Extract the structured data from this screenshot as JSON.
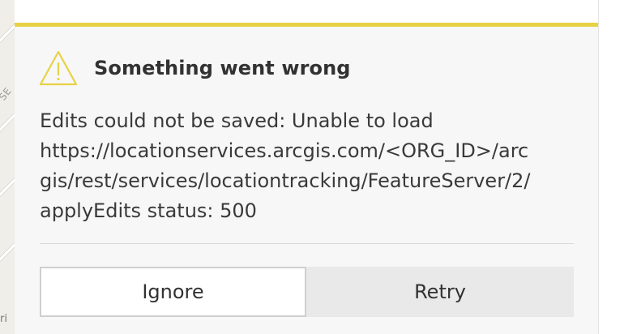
{
  "map": {
    "street_label_rotated": "SE",
    "street_label_bottom": "ri"
  },
  "alert": {
    "icon": "warning-triangle-icon",
    "accent_color": "#e7d245",
    "title": "Something went wrong",
    "message": "Edits could not be saved: Unable to load\nhttps://locationservices.arcgis.com/<ORG_ID>/arc\ngis/rest/services/locationtracking/FeatureServer/2/\napplyEdits status: 500",
    "actions": {
      "ignore_label": "Ignore",
      "retry_label": "Retry"
    }
  }
}
